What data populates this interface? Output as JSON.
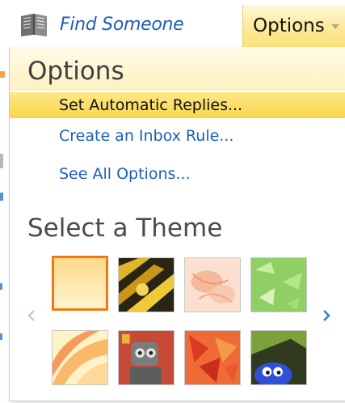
{
  "topbar": {
    "find_someone_label": "Find Someone",
    "options_tab_label": "Options"
  },
  "menu": {
    "title": "Options",
    "items": [
      {
        "label": "Set Automatic Replies...",
        "highlighted": true
      },
      {
        "label": "Create an Inbox Rule...",
        "highlighted": false
      },
      {
        "label": "See All Options...",
        "highlighted": false
      }
    ],
    "theme_section_title": "Select a Theme",
    "themes": [
      {
        "name": "sunny-gradient",
        "selected": true
      },
      {
        "name": "yellow-black-pattern",
        "selected": false
      },
      {
        "name": "peach-floral",
        "selected": false
      },
      {
        "name": "green-leaves",
        "selected": false
      },
      {
        "name": "sunburst-swirl",
        "selected": false
      },
      {
        "name": "robot-character",
        "selected": false
      },
      {
        "name": "red-maple-leaves",
        "selected": false
      },
      {
        "name": "blue-creature",
        "selected": false
      }
    ]
  },
  "icons": {
    "book": "book-icon",
    "dropdown": "chevron-down-icon",
    "prev": "chevron-left-icon",
    "next": "chevron-right-icon"
  },
  "colors": {
    "link": "#1e5fb8",
    "highlight": "#fbd74a",
    "selected_border": "#f07a10",
    "header_bg": "#fdf1c2"
  }
}
